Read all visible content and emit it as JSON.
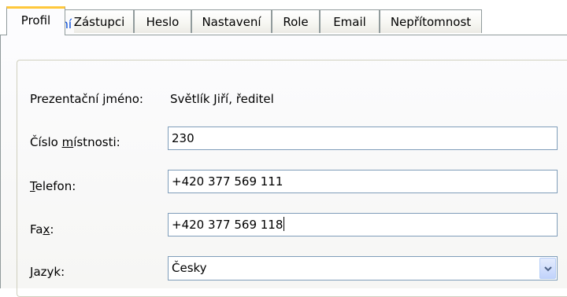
{
  "tabs": [
    {
      "label": "Profil",
      "active": true
    },
    {
      "label": "Zástupci",
      "active": false
    },
    {
      "label": "Heslo",
      "active": false
    },
    {
      "label": "Nastavení",
      "active": false
    },
    {
      "label": "Role",
      "active": false
    },
    {
      "label": "Email",
      "active": false
    },
    {
      "label": "Nepřítomnost",
      "active": false
    }
  ],
  "group": {
    "legend": "Osobní"
  },
  "fields": {
    "presentation_name": {
      "label": "Prezentační jméno:",
      "value": "Světlík Jiří, ředitel"
    },
    "room_number": {
      "label_pre": "Číslo ",
      "label_u": "m",
      "label_post": "ístnosti:",
      "value": "230"
    },
    "phone": {
      "label_pre": "",
      "label_u": "T",
      "label_post": "elefon:",
      "value": "+420 377 569 111"
    },
    "fax": {
      "label_pre": "Fa",
      "label_u": "x",
      "label_post": ":",
      "value": "+420 377 569 118"
    },
    "language": {
      "label_pre": "",
      "label_u": "J",
      "label_post": "azyk:",
      "value": "Česky"
    }
  },
  "colors": {
    "legend": "#0046d5",
    "active_tab_accent": "#ffc83c",
    "input_border": "#7f9db9"
  },
  "icons": {
    "dropdown": "chevron-down-icon"
  }
}
